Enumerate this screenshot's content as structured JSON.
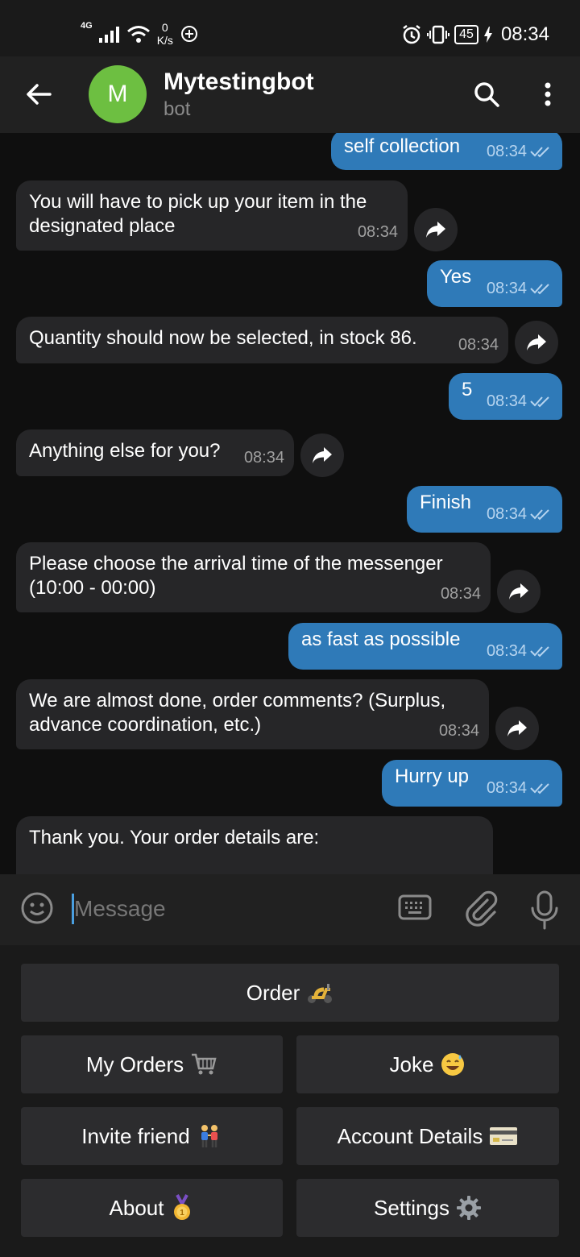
{
  "status_bar": {
    "network": "4G",
    "speed_value": "0",
    "speed_unit": "K/s",
    "battery": "45",
    "time": "08:34"
  },
  "header": {
    "avatar_letter": "M",
    "title": "Mytestingbot",
    "subtitle": "bot"
  },
  "messages": [
    {
      "dir": "out",
      "text": "self collection",
      "time": "08:34"
    },
    {
      "dir": "in",
      "text": "You will have to pick up your item in the\ndesignated place",
      "time": "08:34"
    },
    {
      "dir": "out",
      "text": "Yes",
      "time": "08:34"
    },
    {
      "dir": "in",
      "text": "Quantity should now be selected, in stock 86.",
      "time": "08:34"
    },
    {
      "dir": "out",
      "text": "5",
      "time": "08:34"
    },
    {
      "dir": "in",
      "text": "Anything else for you?",
      "time": "08:34"
    },
    {
      "dir": "out",
      "text": "Finish",
      "time": "08:34"
    },
    {
      "dir": "in",
      "text": "Please choose the arrival time of the messenger\n(10:00 - 00:00)",
      "time": "08:34"
    },
    {
      "dir": "out",
      "text": "as fast as possible",
      "time": "08:34"
    },
    {
      "dir": "in",
      "text": "We are almost done, order comments? (Surplus,\nadvance coordination, etc.)",
      "time": "08:34"
    },
    {
      "dir": "out",
      "text": "Hurry up",
      "time": "08:34"
    },
    {
      "dir": "in",
      "text": "Thank you. Your order details are:",
      "time": ""
    }
  ],
  "input": {
    "placeholder": "Message"
  },
  "keyboard": {
    "order": "Order",
    "my_orders": "My Orders",
    "joke": "Joke",
    "invite_friend": "Invite friend",
    "account_details": "Account Details",
    "about": "About",
    "settings": "Settings"
  },
  "colors": {
    "accent": "#2f7ab8",
    "avatar": "#6dbf41",
    "incoming": "#262628",
    "header": "#212121"
  }
}
